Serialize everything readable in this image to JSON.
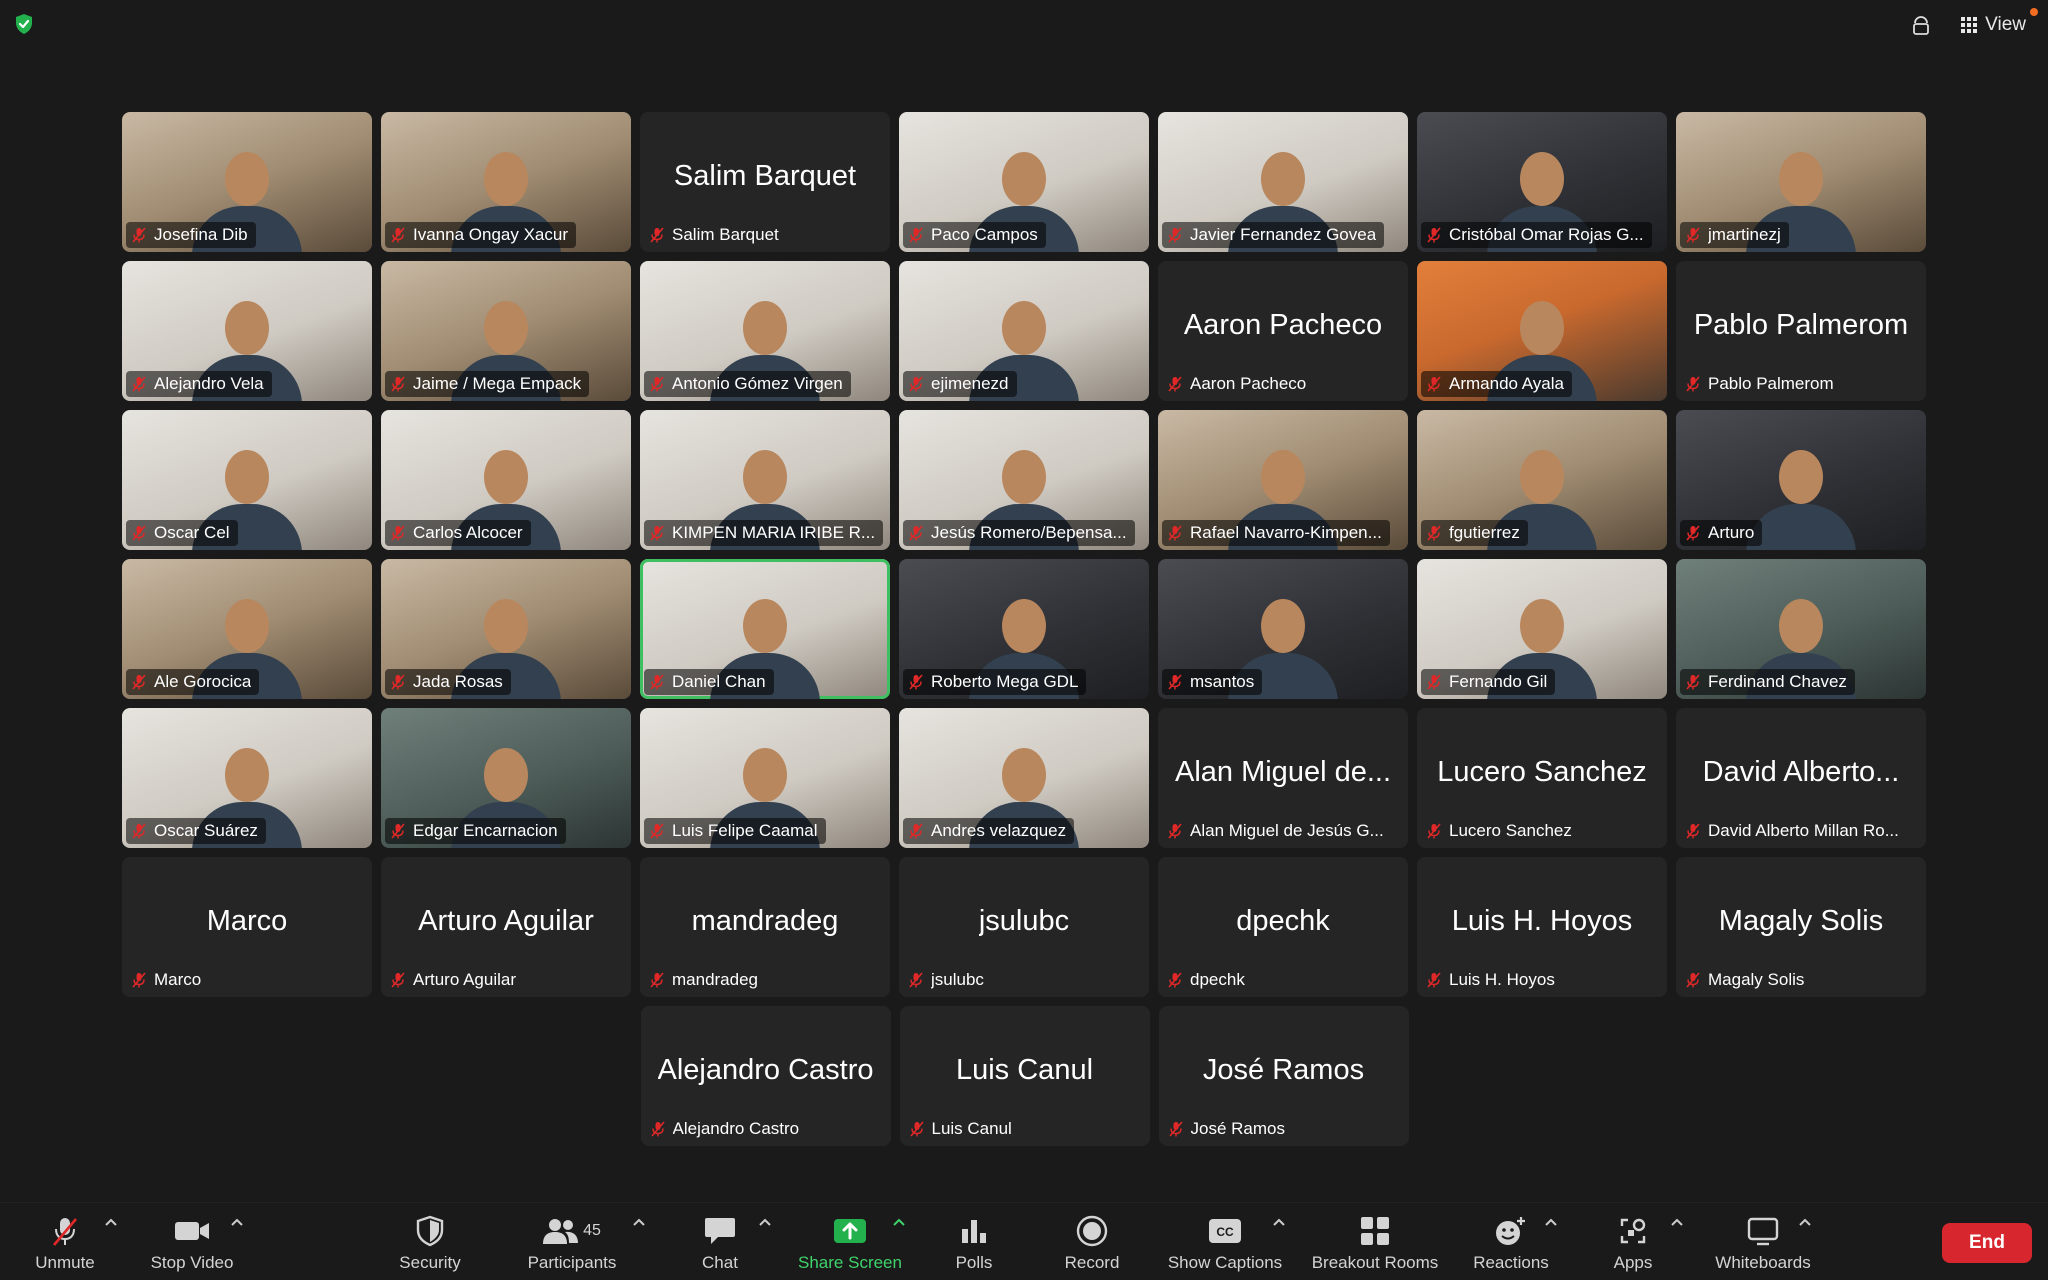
{
  "top": {
    "view_label": "View"
  },
  "rows": [
    {
      "centered": false,
      "tiles": [
        {
          "name": "Josefina Dib",
          "video": true,
          "tone": "warm"
        },
        {
          "name": "Ivanna Ongay Xacur",
          "video": true,
          "tone": "warm"
        },
        {
          "name": "Salim Barquet",
          "video": false,
          "big": "Salim Barquet"
        },
        {
          "name": "Paco Campos",
          "video": true,
          "tone": "light"
        },
        {
          "name": "Javier Fernandez Govea",
          "video": true,
          "tone": "light"
        },
        {
          "name": "Cristóbal Omar Rojas G...",
          "video": true,
          "tone": "dark"
        },
        {
          "name": "jmartinezj",
          "video": true,
          "tone": "warm"
        }
      ]
    },
    {
      "centered": false,
      "tiles": [
        {
          "name": "Alejandro Vela",
          "video": true,
          "tone": "light"
        },
        {
          "name": "Jaime / Mega Empack",
          "video": true,
          "tone": "warm"
        },
        {
          "name": "Antonio Gómez Virgen",
          "video": true,
          "tone": "light"
        },
        {
          "name": "ejimenezd",
          "video": true,
          "tone": "light"
        },
        {
          "name": "Aaron Pacheco",
          "video": false,
          "big": "Aaron Pacheco"
        },
        {
          "name": "Armando Ayala",
          "video": true,
          "tone": "orange"
        },
        {
          "name": "Pablo Palmerom",
          "video": false,
          "big": "Pablo Palmerom"
        }
      ]
    },
    {
      "centered": false,
      "tiles": [
        {
          "name": "Oscar Cel",
          "video": true,
          "tone": "light"
        },
        {
          "name": "Carlos Alcocer",
          "video": true,
          "tone": "light"
        },
        {
          "name": "KIMPEN MARIA IRIBE R...",
          "video": true,
          "tone": "light"
        },
        {
          "name": "Jesús Romero/Bepensa...",
          "video": true,
          "tone": "light"
        },
        {
          "name": "Rafael Navarro-Kimpen...",
          "video": true,
          "tone": "warm"
        },
        {
          "name": "fgutierrez",
          "video": true,
          "tone": "warm"
        },
        {
          "name": "Arturo",
          "video": true,
          "tone": "dark"
        }
      ]
    },
    {
      "centered": false,
      "tiles": [
        {
          "name": "Ale Gorocica",
          "video": true,
          "tone": "warm"
        },
        {
          "name": "Jada Rosas",
          "video": true,
          "tone": "warm"
        },
        {
          "name": "Daniel Chan",
          "video": true,
          "tone": "light",
          "active": true
        },
        {
          "name": "Roberto Mega GDL",
          "video": true,
          "tone": "dark"
        },
        {
          "name": "msantos",
          "video": true,
          "tone": "dark"
        },
        {
          "name": "Fernando Gil",
          "video": true,
          "tone": "light"
        },
        {
          "name": "Ferdinand Chavez",
          "video": true,
          "tone": "teal"
        }
      ]
    },
    {
      "centered": false,
      "tiles": [
        {
          "name": "Oscar Suárez",
          "video": true,
          "tone": "light"
        },
        {
          "name": "Edgar Encarnacion",
          "video": true,
          "tone": "teal"
        },
        {
          "name": "Luis Felipe Caamal",
          "video": true,
          "tone": "light"
        },
        {
          "name": "Andres velazquez",
          "video": true,
          "tone": "light"
        },
        {
          "name": "Alan Miguel de Jesús G...",
          "video": false,
          "big": "Alan Miguel de..."
        },
        {
          "name": "Lucero Sanchez",
          "video": false,
          "big": "Lucero Sanchez"
        },
        {
          "name": "David Alberto Millan Ro...",
          "video": false,
          "big": "David Alberto..."
        }
      ]
    },
    {
      "centered": false,
      "tiles": [
        {
          "name": "Marco",
          "video": false,
          "big": "Marco"
        },
        {
          "name": "Arturo Aguilar",
          "video": false,
          "big": "Arturo Aguilar"
        },
        {
          "name": "mandradeg",
          "video": false,
          "big": "mandradeg"
        },
        {
          "name": "jsulubc",
          "video": false,
          "big": "jsulubc"
        },
        {
          "name": "dpechk",
          "video": false,
          "big": "dpechk"
        },
        {
          "name": "Luis H. Hoyos",
          "video": false,
          "big": "Luis H. Hoyos"
        },
        {
          "name": "Magaly Solis",
          "video": false,
          "big": "Magaly Solis"
        }
      ]
    },
    {
      "centered": true,
      "tiles": [
        {
          "name": "Alejandro Castro",
          "video": false,
          "big": "Alejandro Castro"
        },
        {
          "name": "Luis Canul",
          "video": false,
          "big": "Luis Canul"
        },
        {
          "name": "José Ramos",
          "video": false,
          "big": "José Ramos"
        }
      ]
    }
  ],
  "toolbar": {
    "unmute": "Unmute",
    "stop_video": "Stop Video",
    "security": "Security",
    "participants": "Participants",
    "participant_count": "45",
    "chat": "Chat",
    "share_screen": "Share Screen",
    "polls": "Polls",
    "record": "Record",
    "show_captions": "Show Captions",
    "breakout_rooms": "Breakout Rooms",
    "reactions": "Reactions",
    "apps": "Apps",
    "whiteboards": "Whiteboards",
    "end": "End"
  },
  "colors": {
    "accent_green": "#3fd36b",
    "end_red": "#d8262f",
    "mic_off_red": "#e02828",
    "background": "#1a1a1a"
  },
  "icons": [
    "shield-check-icon",
    "record-indicator-icon",
    "grid-view-icon",
    "mic-off-icon",
    "camera-icon",
    "security-shield-icon",
    "participants-icon",
    "chat-icon",
    "share-screen-icon",
    "polls-icon",
    "record-icon",
    "captions-icon",
    "breakout-rooms-icon",
    "reactions-icon",
    "apps-icon",
    "whiteboards-icon"
  ]
}
